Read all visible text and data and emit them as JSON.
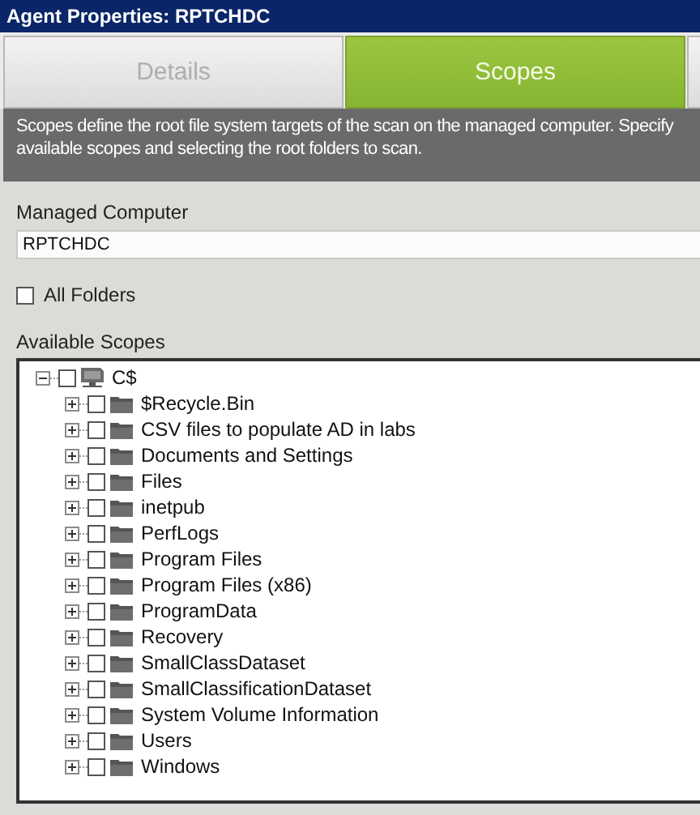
{
  "window": {
    "title": "Agent Properties: RPTCHDC"
  },
  "tabs": [
    {
      "label": "Details",
      "selected": false
    },
    {
      "label": "Scopes",
      "selected": true
    },
    {
      "selected": false
    }
  ],
  "description": [
    "Scopes define the root file system targets of the scan on the managed computer.  Specify",
    "available scopes and selecting the root folders to scan."
  ],
  "managed_computer": {
    "label": "Managed Computer",
    "value": "RPTCHDC"
  },
  "all_folders": {
    "label": "All Folders",
    "checked": false
  },
  "available_scopes": {
    "label": "Available Scopes",
    "tree": [
      {
        "label": "C$",
        "kind": "drive",
        "checked": false,
        "expanded": true,
        "children": [
          {
            "label": "$Recycle.Bin",
            "kind": "folder",
            "checked": false,
            "expanded": false
          },
          {
            "label": "CSV files to populate AD in labs",
            "kind": "folder",
            "checked": false,
            "expanded": false
          },
          {
            "label": "Documents and Settings",
            "kind": "folder",
            "checked": false,
            "expanded": false
          },
          {
            "label": "Files",
            "kind": "folder",
            "checked": false,
            "expanded": false
          },
          {
            "label": "inetpub",
            "kind": "folder",
            "checked": false,
            "expanded": false
          },
          {
            "label": "PerfLogs",
            "kind": "folder",
            "checked": false,
            "expanded": false
          },
          {
            "label": "Program Files",
            "kind": "folder",
            "checked": false,
            "expanded": false
          },
          {
            "label": "Program Files (x86)",
            "kind": "folder",
            "checked": false,
            "expanded": false
          },
          {
            "label": "ProgramData",
            "kind": "folder",
            "checked": false,
            "expanded": false
          },
          {
            "label": "Recovery",
            "kind": "folder",
            "checked": false,
            "expanded": false
          },
          {
            "label": "SmallClassDataset",
            "kind": "folder",
            "checked": false,
            "expanded": false
          },
          {
            "label": "SmallClassificationDataset",
            "kind": "folder",
            "checked": false,
            "expanded": false
          },
          {
            "label": "System Volume Information",
            "kind": "folder",
            "checked": false,
            "expanded": false
          },
          {
            "label": "Users",
            "kind": "folder",
            "checked": false,
            "expanded": false
          },
          {
            "label": "Windows",
            "kind": "folder",
            "checked": false,
            "expanded": false
          }
        ]
      }
    ]
  }
}
